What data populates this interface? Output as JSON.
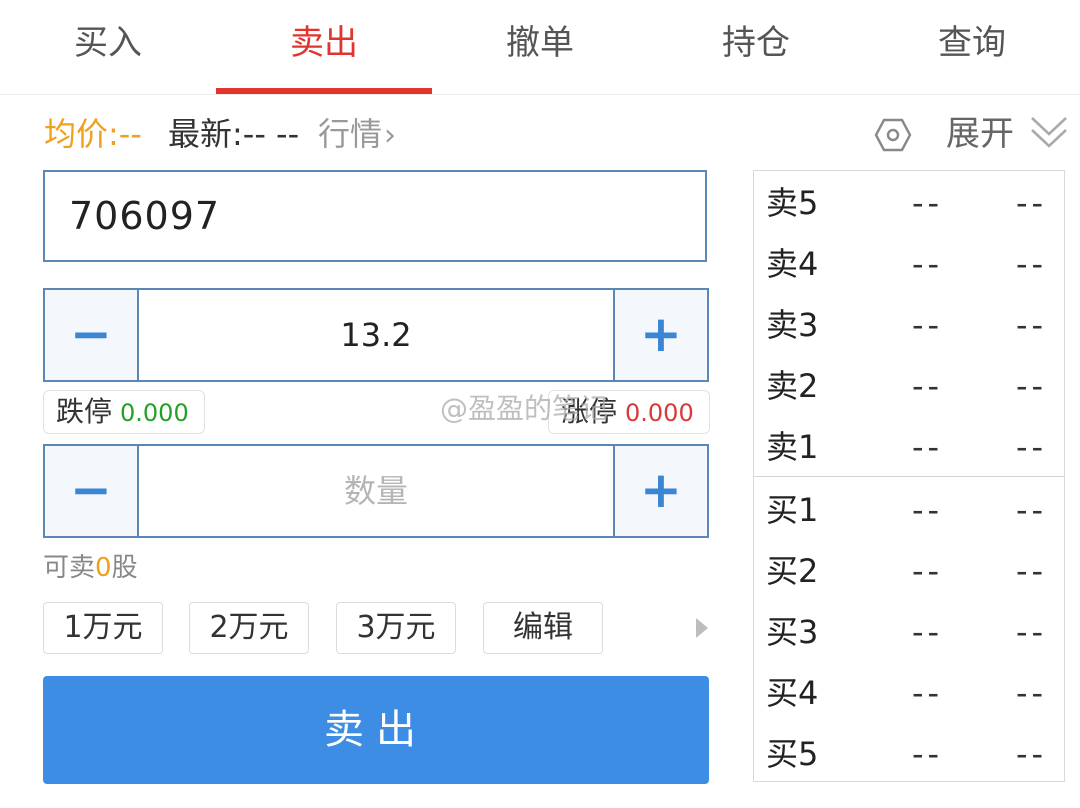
{
  "tabs": [
    {
      "label": "买入"
    },
    {
      "label": "卖出"
    },
    {
      "label": "撤单"
    },
    {
      "label": "持仓"
    },
    {
      "label": "查询"
    }
  ],
  "active_tab": "卖出",
  "info": {
    "avg_price": "均价:--",
    "latest": "最新:-- --",
    "market": "行情",
    "expand": "展开"
  },
  "code_input": {
    "value": "706097"
  },
  "price_stepper": {
    "value": "13.2"
  },
  "limits": {
    "down_label": "跌停",
    "down_value": "0.000",
    "up_label": "涨停",
    "up_value": "0.000"
  },
  "quantity_stepper": {
    "placeholder": "数量"
  },
  "sellable": {
    "prefix": "可卖",
    "count": "0",
    "suffix": "股"
  },
  "quick_amounts": [
    "1万元",
    "2万元",
    "3万元",
    "编辑"
  ],
  "submit_label": "卖出",
  "order_book": {
    "asks": [
      {
        "name": "卖5",
        "price": "--",
        "volume": "--"
      },
      {
        "name": "卖4",
        "price": "--",
        "volume": "--"
      },
      {
        "name": "卖3",
        "price": "--",
        "volume": "--"
      },
      {
        "name": "卖2",
        "price": "--",
        "volume": "--"
      },
      {
        "name": "卖1",
        "price": "--",
        "volume": "--"
      }
    ],
    "bids": [
      {
        "name": "买1",
        "price": "--",
        "volume": "--"
      },
      {
        "name": "买2",
        "price": "--",
        "volume": "--"
      },
      {
        "name": "买3",
        "price": "--",
        "volume": "--"
      },
      {
        "name": "买4",
        "price": "--",
        "volume": "--"
      },
      {
        "name": "买5",
        "price": "--",
        "volume": "--"
      }
    ]
  },
  "watermark": "@盈盈的笔记",
  "colors": {
    "accent_red": "#e2342f",
    "primary_blue": "#3e8de5",
    "border_blue": "#5b87b5",
    "orange": "#f0a020",
    "green": "#23a223"
  },
  "icons": [
    "settings-hexagon-icon",
    "double-chevron-down-icon",
    "chevron-right-icon",
    "minus-icon",
    "plus-icon",
    "arrow-right-icon"
  ]
}
